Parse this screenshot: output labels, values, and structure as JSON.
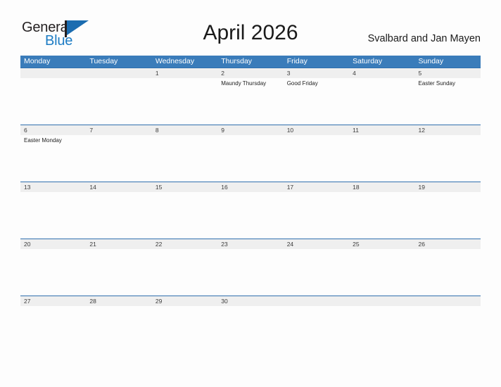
{
  "brand": {
    "name_top": "General",
    "name_bottom": "Blue",
    "accent_color": "#1d7cc4",
    "flag_color": "#1b6cb0"
  },
  "header": {
    "title": "April 2026",
    "location": "Svalbard and Jan Mayen"
  },
  "calendar": {
    "header_bg": "#3a7cba",
    "band_bg": "#efefef",
    "rule_color": "#2f6fae",
    "weekdays": [
      "Monday",
      "Tuesday",
      "Wednesday",
      "Thursday",
      "Friday",
      "Saturday",
      "Sunday"
    ],
    "weeks": [
      [
        {
          "day": "",
          "event": ""
        },
        {
          "day": "",
          "event": ""
        },
        {
          "day": "1",
          "event": ""
        },
        {
          "day": "2",
          "event": "Maundy Thursday"
        },
        {
          "day": "3",
          "event": "Good Friday"
        },
        {
          "day": "4",
          "event": ""
        },
        {
          "day": "5",
          "event": "Easter Sunday"
        }
      ],
      [
        {
          "day": "6",
          "event": "Easter Monday"
        },
        {
          "day": "7",
          "event": ""
        },
        {
          "day": "8",
          "event": ""
        },
        {
          "day": "9",
          "event": ""
        },
        {
          "day": "10",
          "event": ""
        },
        {
          "day": "11",
          "event": ""
        },
        {
          "day": "12",
          "event": ""
        }
      ],
      [
        {
          "day": "13",
          "event": ""
        },
        {
          "day": "14",
          "event": ""
        },
        {
          "day": "15",
          "event": ""
        },
        {
          "day": "16",
          "event": ""
        },
        {
          "day": "17",
          "event": ""
        },
        {
          "day": "18",
          "event": ""
        },
        {
          "day": "19",
          "event": ""
        }
      ],
      [
        {
          "day": "20",
          "event": ""
        },
        {
          "day": "21",
          "event": ""
        },
        {
          "day": "22",
          "event": ""
        },
        {
          "day": "23",
          "event": ""
        },
        {
          "day": "24",
          "event": ""
        },
        {
          "day": "25",
          "event": ""
        },
        {
          "day": "26",
          "event": ""
        }
      ],
      [
        {
          "day": "27",
          "event": ""
        },
        {
          "day": "28",
          "event": ""
        },
        {
          "day": "29",
          "event": ""
        },
        {
          "day": "30",
          "event": ""
        },
        {
          "day": "",
          "event": ""
        },
        {
          "day": "",
          "event": ""
        },
        {
          "day": "",
          "event": ""
        }
      ]
    ]
  }
}
